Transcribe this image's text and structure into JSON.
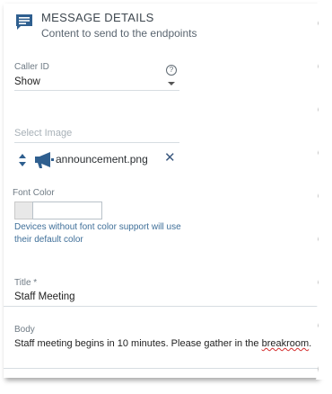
{
  "header": {
    "title": "MESSAGE DETAILS",
    "subtitle": "Content to send to the endpoints",
    "icon": "message-icon"
  },
  "caller_id": {
    "label": "Caller ID",
    "value": "Show",
    "help_glyph": "?",
    "help_icon": "help-circle-icon",
    "dropdown_icon": "chevron-down-icon"
  },
  "select_image": {
    "placeholder": "Select Image",
    "file_name": "announcement.png",
    "file_icon": "megaphone-icon",
    "reorder_icon": "sort-icon",
    "remove_glyph": "✕"
  },
  "font_color": {
    "label": "Font Color",
    "hint": "Devices without font color support will use their default color"
  },
  "title_field": {
    "label": "Title *",
    "value": "Staff Meeting"
  },
  "body_field": {
    "label": "Body",
    "value_before": "Staff meeting begins in 10 minutes. Please gather in the ",
    "value_misspelled": "breakroom",
    "value_after": "."
  },
  "colors": {
    "accent": "#2f5f8f",
    "hint_text": "#3f6f99",
    "field_line": "#d7dde2"
  }
}
